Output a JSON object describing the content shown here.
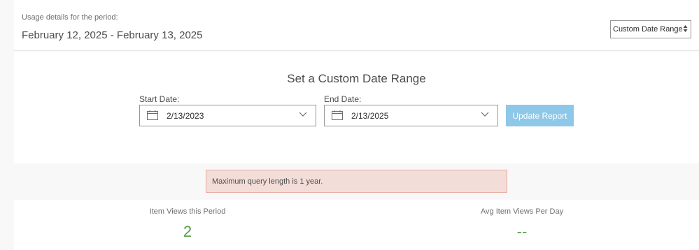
{
  "header": {
    "caption": "Usage details for the period:",
    "period": "February 12, 2025 - February 13, 2025",
    "range_select": {
      "selected": "Custom Date Range",
      "icon": "sort-arrows-icon"
    }
  },
  "custom_range": {
    "title": "Set a Custom Date Range",
    "start": {
      "label": "Start Date:",
      "value": "2/13/2023",
      "icon": "calendar-icon"
    },
    "end": {
      "label": "End Date:",
      "value": "2/13/2025",
      "icon": "calendar-icon"
    },
    "update_label": "Update Report"
  },
  "alert": {
    "message": "Maximum query length is 1 year."
  },
  "stats": {
    "views": {
      "label": "Item Views this Period",
      "value": "2"
    },
    "avg": {
      "label": "Avg Item Views Per Day",
      "value": "--"
    }
  },
  "colors": {
    "accent_button": "#8ec8e8",
    "alert_bg": "#f3ddd9",
    "alert_border": "#e6aaa0",
    "stat_value": "#5a9a4a"
  }
}
